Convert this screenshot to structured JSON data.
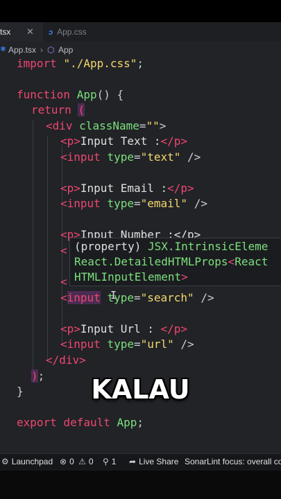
{
  "tabs": [
    {
      "label": "tsx",
      "close": "✕"
    },
    {
      "label": "App.css"
    }
  ],
  "breadcrumb": {
    "file": "App.tsx",
    "component": "App"
  },
  "code": {
    "import_kw": "import",
    "import_path": "\"./App.css\"",
    "semicolon": ";",
    "function_kw": "function",
    "func_name": "App",
    "func_sig": "() {",
    "return_kw": "return",
    "paren_open": "(",
    "div_open_tag": "<div",
    "class_attr": "className",
    "class_value": "\"\"",
    "div_open_close": ">",
    "p1_text": "Input Text :",
    "input1_type": "\"text\"",
    "p2_text": "Input Email :",
    "input2_type": "\"email\"",
    "p3_partial": "Input Number :</p>",
    "input4_type": "\"search\"",
    "p5_text": "Input Url : ",
    "input5_type": "\"url\"",
    "div_close": "</div>",
    "paren_close": ")",
    "func_close": "}",
    "export_line_kw": "export default",
    "export_name": "App"
  },
  "tooltip": {
    "line1_prefix": "(property) ",
    "line1_type": "JSX.IntrinsicEleme",
    "line2_a": "React.DetailedHTMLProps",
    "line2_lt": "<",
    "line2_b": "React",
    "line3": "HTMLInputElement",
    "line3_gt": ">"
  },
  "caption": "KALAU",
  "statusbar": {
    "launchpad": "Launchpad",
    "errors": "0",
    "warnings": "0",
    "ports": "1",
    "liveshare": "Live Share",
    "sonarlint": "SonarLint focus: overall code"
  }
}
